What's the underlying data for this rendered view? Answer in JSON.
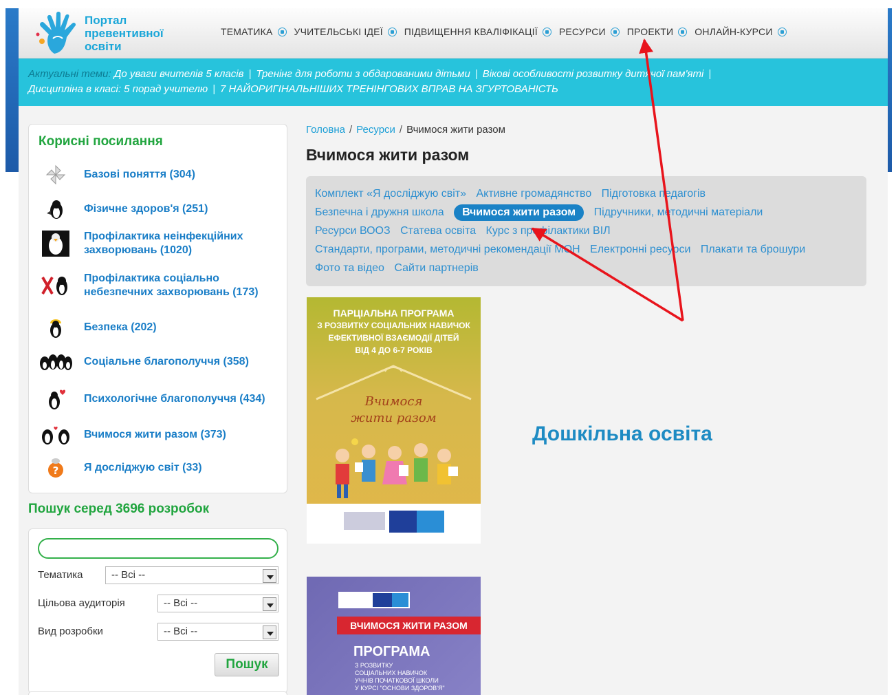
{
  "header": {
    "logo_lines": [
      "Портал",
      "превентивної",
      "освіти"
    ],
    "nav": [
      "ТЕМАТИКА",
      "УЧИТЕЛЬСЬКІ ІДЕЇ",
      "ПІДВИЩЕННЯ КВАЛІФІКАЦІЇ",
      "РЕСУРСИ",
      "ПРОЕКТИ",
      "ОНЛАЙН-КУРСИ"
    ]
  },
  "ticker": {
    "label": "Актуальні теми:",
    "items": [
      "До уваги вчителів 5 класів",
      "Тренінг для роботи з обдарованими дітьми",
      "Вікові особливості розвитку дитячої пам'яті",
      "Дисципліна в класі: 5 порад учителю",
      "7 НАЙОРИГІНАЛЬНІШИХ ТРЕНІНГОВИХ ВПРАВ НА ЗГУРТОВАНІСТЬ"
    ]
  },
  "sidebar": {
    "title": "Корисні посилання",
    "links": [
      {
        "label": "Базові поняття (304)",
        "icon": "pinwheel-icon"
      },
      {
        "label": "Фізичне здоров'я (251)",
        "icon": "penguin-icon"
      },
      {
        "label": "Профілактика неінфекційних захворювань (1020)",
        "icon": "penguin-photo-icon"
      },
      {
        "label": "Профілактика соціально небезпечних захворювань (173)",
        "icon": "penguin-warning-icon"
      },
      {
        "label": "Безпека (202)",
        "icon": "penguin-helmet-icon"
      },
      {
        "label": "Соціальне благополуччя (358)",
        "icon": "penguin-group-icon"
      },
      {
        "label": "Психологічне благополуччя (434)",
        "icon": "penguin-heart-icon"
      },
      {
        "label": "Вчимося жити разом (373)",
        "icon": "penguin-pair-icon"
      },
      {
        "label": "Я досліджую світ (33)",
        "icon": "question-globe-icon"
      }
    ]
  },
  "search": {
    "title": "Пошук серед 3696 розробок",
    "input_value": "",
    "filters": [
      {
        "label": "Тематика",
        "value": "-- Всі --"
      },
      {
        "label": "Цільова аудиторія",
        "value": "-- Всі --"
      },
      {
        "label": "Вид розробки",
        "value": "-- Всі --"
      }
    ],
    "button": "Пошук"
  },
  "breadcrumb": {
    "home": "Головна",
    "section": "Ресурси",
    "current": "Вчимося жити разом"
  },
  "page_title": "Вчимося жити разом",
  "tags": [
    {
      "label": "Комплект «Я досліджую світ»",
      "active": false
    },
    {
      "label": "Активне громадянство",
      "active": false
    },
    {
      "label": "Підготовка педагогів",
      "active": false
    },
    {
      "label": "Безпечна і дружня школа",
      "active": false
    },
    {
      "label": "Вчимося жити разом",
      "active": true
    },
    {
      "label": "Підручники, методичні матеріали",
      "active": false
    },
    {
      "label": "Ресурси ВООЗ",
      "active": false
    },
    {
      "label": "Статева освіта",
      "active": false
    },
    {
      "label": "Курс з профілактики ВІЛ",
      "active": false
    },
    {
      "label": "Стандарти, програми, методичні рекомендації МОН",
      "active": false
    },
    {
      "label": "Електронні ресурси",
      "active": false
    },
    {
      "label": "Плакати та брошури",
      "active": false
    },
    {
      "label": "Фото та відео",
      "active": false
    },
    {
      "label": "Сайти партнерів",
      "active": false
    }
  ],
  "cover1": {
    "lines": [
      "ПАРЦІАЛЬНА ПРОГРАМА",
      "З РОЗВИТКУ СОЦІАЛЬНИХ НАВИЧОК",
      "ЕФЕКТИВНОЇ ВЗАЄМОДІЇ ДІТЕЙ",
      "ВІД 4 ДО 6-7 РОКІВ"
    ],
    "script_lines": [
      "Вчимося",
      "жити разом"
    ]
  },
  "cover2": {
    "band": "ВЧИМОСЯ ЖИТИ РАЗОМ",
    "title": "ПРОГРАМА",
    "sub_lines": [
      "З РОЗВИТКУ",
      "СОЦІАЛЬНИХ НАВИЧОК",
      "УЧНІВ ПОЧАТКОВОЇ ШКОЛИ",
      "У КУРСІ \"ОСНОВИ ЗДОРОВ'Я\""
    ]
  },
  "preschool_label": "Дошкільна освіта",
  "colors": {
    "accent": "#1a82c6",
    "green": "#21a53f",
    "ticker": "#27c3dc",
    "arrow": "#e8141c"
  }
}
